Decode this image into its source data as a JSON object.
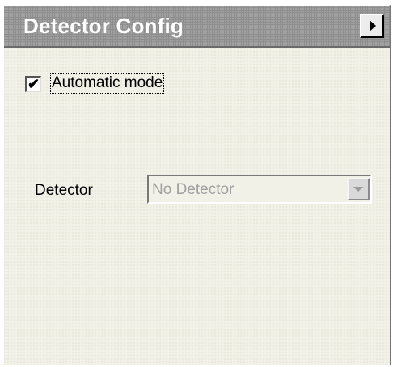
{
  "panel": {
    "title": "Detector Config",
    "menu_button_icon": "triangle-right-icon"
  },
  "automatic_mode": {
    "label": "Automatic mode",
    "checked": true,
    "check_glyph": "✔"
  },
  "detector": {
    "label": "Detector",
    "selected": "No Detector",
    "enabled": false
  },
  "colors": {
    "titlebar": "#8e8e8e",
    "panel_background": "#f2f1e8",
    "disabled_text": "#a0a0a0"
  }
}
